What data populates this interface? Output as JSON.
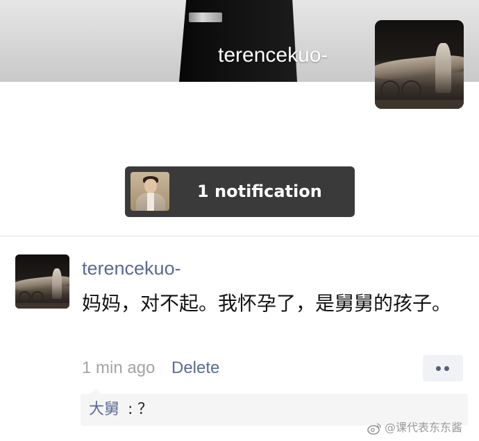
{
  "profile": {
    "name": "terencekuo-"
  },
  "notification": {
    "label": "1 notification"
  },
  "post": {
    "author": "terencekuo-",
    "text": "妈妈，对不起。我怀孕了，是舅舅的孩子。",
    "time": "1 min ago",
    "delete_label": "Delete",
    "more_icon": "more-dots-icon",
    "comments": [
      {
        "author": "大舅",
        "separator": ":",
        "text": "？"
      }
    ]
  },
  "watermark": {
    "text": "@课代表东东酱",
    "icon": "weibo-icon"
  },
  "colors": {
    "link_blue": "#5a6a93",
    "notification_bg": "#3a3a3a",
    "muted_text": "#a3a3a3"
  }
}
